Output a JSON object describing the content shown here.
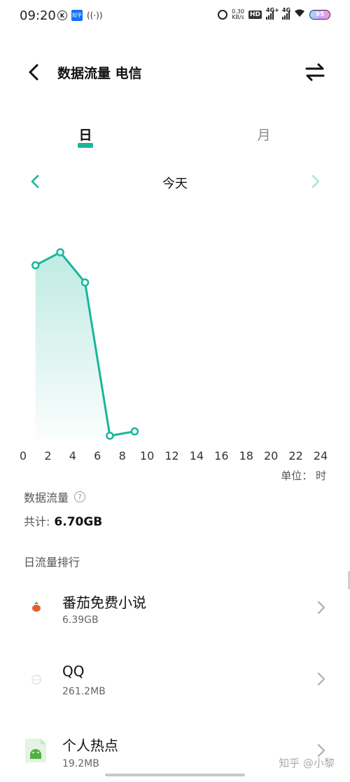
{
  "status_bar": {
    "time": "09:20",
    "speed_value": "0.30",
    "speed_unit": "KB/s",
    "hd_label": "HD",
    "net1": "4G+",
    "net2": "4G",
    "battery": "95",
    "zhihu_badge": "知乎"
  },
  "header": {
    "title": "数据流量 电信",
    "back_icon": "chevron-left-icon",
    "switch_icon": "swap-arrows-icon"
  },
  "tabs": [
    {
      "label": "日",
      "selected": true
    },
    {
      "label": "月",
      "selected": false
    }
  ],
  "date_nav": {
    "label": "今天"
  },
  "accent_color": "#19b69a",
  "chart_data": {
    "type": "area",
    "x": [
      1,
      3,
      5,
      7,
      9
    ],
    "values": [
      0.81,
      0.87,
      0.73,
      0.02,
      0.04
    ],
    "xticks": [
      "0",
      "2",
      "4",
      "6",
      "8",
      "10",
      "12",
      "14",
      "16",
      "18",
      "20",
      "22",
      "24"
    ],
    "xlim": [
      0,
      24
    ],
    "ylabel": "",
    "xlabel": "",
    "color": "#19b69a",
    "grid": false
  },
  "unit_label": "单位： 时",
  "summary": {
    "title": "数据流量",
    "total_label": "共计:",
    "total_value": "6.70GB"
  },
  "ranking": {
    "title": "日流量排行",
    "apps": [
      {
        "name": "番茄免费小说",
        "size": "6.39GB",
        "icon": "tomato-novel-icon"
      },
      {
        "name": "QQ",
        "size": "261.2MB",
        "icon": "qq-icon"
      },
      {
        "name": "个人热点",
        "size": "19.2MB",
        "icon": "android-file-icon"
      }
    ]
  },
  "watermark": "知乎 @小黎"
}
